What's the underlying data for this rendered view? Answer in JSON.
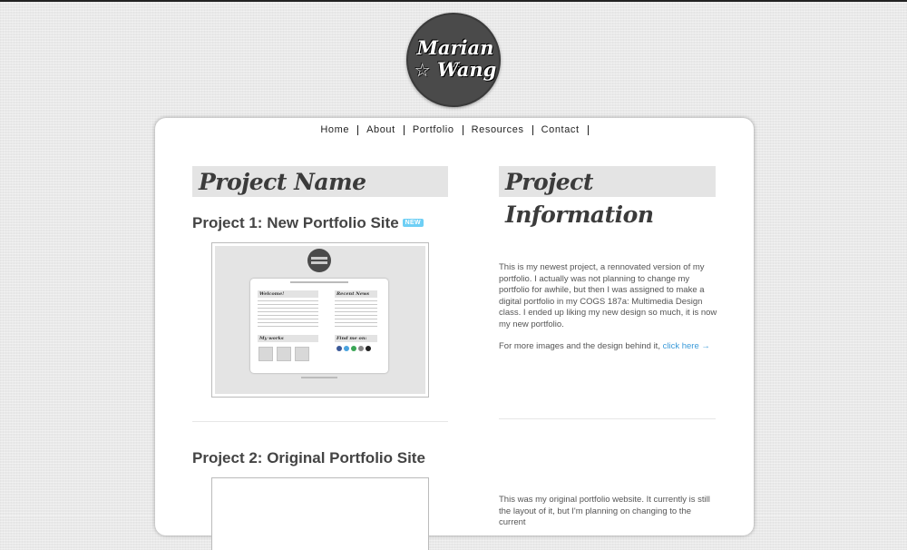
{
  "logo": {
    "line1": "Marian",
    "line2": "Wang",
    "star": "☆"
  },
  "nav": {
    "items": [
      "Home",
      "About",
      "Portfolio",
      "Resources",
      "Contact"
    ]
  },
  "left_column": {
    "heading": "Project Name"
  },
  "right_column": {
    "heading": "Project Information"
  },
  "projects": [
    {
      "title": "Project 1: New Portfolio Site",
      "badge": "NEW",
      "info_paragraph": "This is my newest project, a rennovated version of my portfolio. I actually was not planning to change my portfolio for awhile, but then I was assigned to make a digital portfolio in my COGS 187a: Multimedia Design class. I ended up liking my new design so much, it is now my new portfolio.",
      "more_text": "For more images and the design behind it, ",
      "more_link": "click here →"
    },
    {
      "title": "Project 2: Original Portfolio Site",
      "info_paragraph": "This was my original portfolio website. It currently is still the layout of it, but I'm planning on changing to the current"
    }
  ],
  "thumbnail": {
    "welcome_heading": "Welcome!",
    "news_heading": "Recent News",
    "works_heading": "My works",
    "findme_heading": "Find me on:",
    "social_colors": [
      "#3b5998",
      "#4aa3df",
      "#3aa655",
      "#888888",
      "#222222"
    ]
  }
}
